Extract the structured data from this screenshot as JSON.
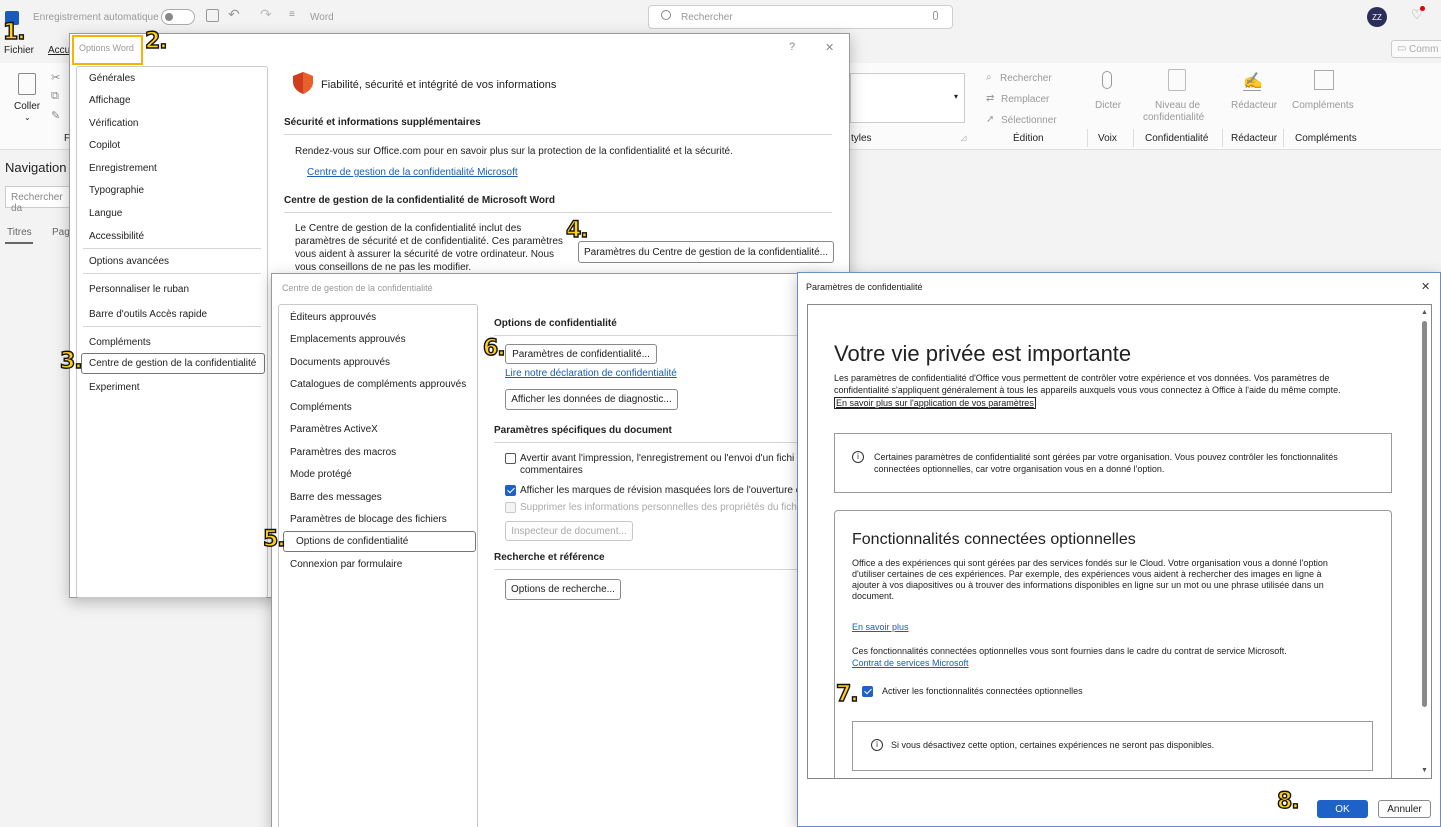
{
  "titlebar": {
    "autosave": "Enregistrement automatique",
    "app": "Word",
    "search_placeholder": "Rechercher",
    "avatar": "ZZ",
    "comment_btn": "Comm"
  },
  "ribbon": {
    "tabs": [
      "Fichier",
      "Accu"
    ],
    "paste": "Coller",
    "styles": "tyles",
    "find": "Rechercher",
    "replace": "Remplacer",
    "select": "Sélectionner",
    "dictate": "Dicter",
    "sensitivity": [
      "Niveau de",
      "confidentialité"
    ],
    "editor": "Rédacteur",
    "addins": "Compléments",
    "groups": [
      "Édition",
      "Voix",
      "Confidentialité",
      "Rédacteur",
      "Compléments"
    ],
    "group_cut": "F"
  },
  "navpane": {
    "title": "Navigation",
    "search_placeholder": "Rechercher da",
    "tabs": [
      "Titres",
      "Pag"
    ]
  },
  "markers": [
    "1.",
    "2.",
    "3.",
    "4.",
    "5.",
    "6.",
    "7.",
    "8."
  ],
  "word_options": {
    "title": "Options Word",
    "help": "?",
    "close": "✕",
    "nav": [
      "Générales",
      "Affichage",
      "Vérification",
      "Copilot",
      "Enregistrement",
      "Typographie",
      "Langue",
      "Accessibilité",
      "Options avancées",
      "Personnaliser le ruban",
      "Barre d'outils Accès rapide",
      "Compléments",
      "Centre de gestion de la confidentialité",
      "Experiment"
    ],
    "header": "Fiabilité, sécurité et intégrité de vos informations",
    "sec1_title": "Sécurité et informations supplémentaires",
    "sec1_text": "Rendez-vous sur Office.com pour en savoir plus sur la protection de la confidentialité et la sécurité.",
    "sec1_link": "Centre de gestion de la confidentialité Microsoft",
    "sec2_title": "Centre de gestion de la confidentialité de Microsoft Word",
    "sec2_text": [
      "Le Centre de gestion de la confidentialité inclut des",
      "paramètres de sécurité et de confidentialité. Ces paramètres",
      "vous aident à assurer la sécurité de votre ordinateur. Nous",
      "vous conseillons de ne pas les modifier."
    ],
    "sec2_button": "Paramètres du Centre de gestion de la confidentialité..."
  },
  "trust_center": {
    "title": "Centre de gestion de la confidentialité",
    "nav": [
      "Éditeurs approuvés",
      "Emplacements approuvés",
      "Documents approuvés",
      "Catalogues de compléments approuvés",
      "Compléments",
      "Paramètres ActiveX",
      "Paramètres des macros",
      "Mode protégé",
      "Barre des messages",
      "Paramètres de blocage des fichiers",
      "Options de confidentialité",
      "Connexion par formulaire"
    ],
    "privacy_title": "Options de confidentialité",
    "privacy_button": "Paramètres de confidentialité...",
    "privacy_link": "Lire notre déclaration de confidentialité",
    "diag_button": "Afficher les données de diagnostic...",
    "doc_title": "Paramètres spécifiques du document",
    "doc_opt1": [
      "Avertir avant l'impression, l'enregistrement ou l'envoi d'un fichi",
      "commentaires"
    ],
    "doc_opt2": "Afficher les marques de révision masquées lors de l'ouverture o",
    "doc_opt3": "Supprimer les informations personnelles des propriétés du fichi",
    "inspector_button": "Inspecteur de document...",
    "research_title": "Recherche et référence",
    "research_button": "Options de recherche..."
  },
  "privacy_dialog": {
    "title": "Paramètres de confidentialité",
    "close": "✕",
    "heading": "Votre vie privée est importante",
    "intro": [
      "Les paramètres de confidentialité d'Office vous permettent de contrôler votre expérience et vos données. Vos paramètres de",
      "confidentialité s'appliquent généralement à tous les appareils auxquels vous vous connectez à Office à l'aide du même compte."
    ],
    "intro_link": "En savoir plus sur l'application de vos paramètres",
    "info_box": [
      "Certaines paramètres de confidentialité sont gérées par votre organisation. Vous pouvez contrôler les fonctionnalités",
      "connectées optionnelles, car votre organisation vous en a donné l'option."
    ],
    "opt_heading": "Fonctionnalités connectées optionnelles",
    "opt_text": [
      "Office a des expériences qui sont gérées par des services fondés sur le Cloud. Votre organisation vous a donné l'option",
      "d'utiliser certaines de ces expériences. Par exemple, des expériences vous aident à rechercher des images en ligne à",
      "ajouter à vos diapositives ou à trouver des informations disponibles en ligne sur un mot ou une phrase utilisée dans un",
      "document."
    ],
    "learn_more": "En savoir plus",
    "contract_text": "Ces fonctionnalités connectées optionnelles vous sont fournies dans le cadre du contrat de service Microsoft.",
    "contract_link": "Contrat de services Microsoft",
    "checkbox_label": "Activer les fonctionnalités connectées optionnelles",
    "note": "Si vous désactivez cette option, certaines expériences ne seront pas disponibles.",
    "ok": "OK",
    "cancel": "Annuler"
  },
  "colors": {
    "accent": "#1e62c8",
    "marker": "#ffcf1a",
    "highlight": "#f4b400"
  }
}
